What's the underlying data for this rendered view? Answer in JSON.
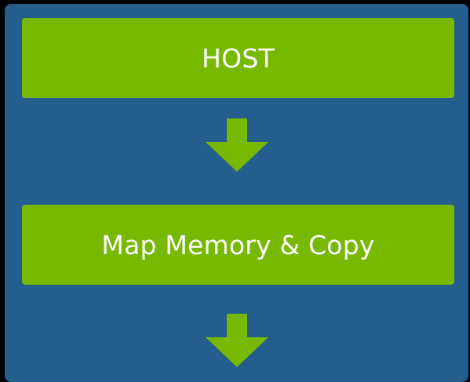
{
  "diagram": {
    "steps": [
      {
        "label": "HOST"
      },
      {
        "label": "Map Memory & Copy"
      }
    ],
    "colors": {
      "page_background": "#000000",
      "panel_background": "#245e8c",
      "box_fill": "#76b900",
      "arrow_fill": "#76b900",
      "text_color": "#ffffff"
    },
    "arrow_icon": "arrow-down-icon"
  }
}
